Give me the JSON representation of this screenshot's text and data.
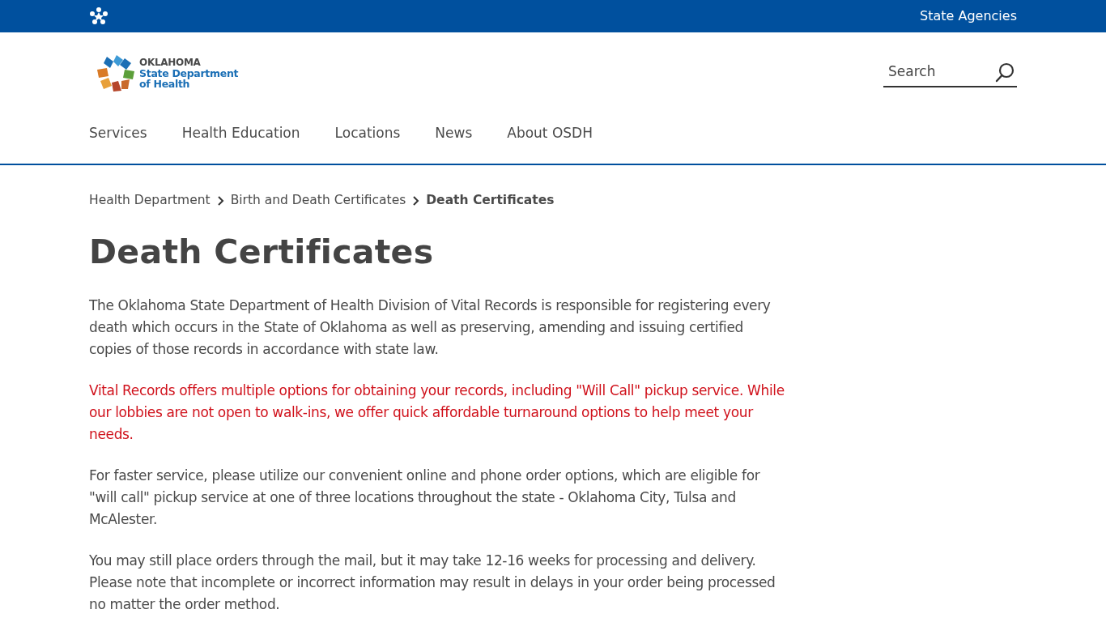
{
  "top_bar": {
    "link": "State Agencies"
  },
  "logo": {
    "lines": [
      "OKLAHOMA",
      "State Department",
      "of Health"
    ]
  },
  "search": {
    "placeholder": "Search"
  },
  "nav": [
    {
      "label": "Services"
    },
    {
      "label": "Health Education"
    },
    {
      "label": "Locations"
    },
    {
      "label": "News"
    },
    {
      "label": "About OSDH"
    }
  ],
  "breadcrumbs": [
    {
      "label": "Health Department",
      "current": false
    },
    {
      "label": "Birth and Death Certificates",
      "current": false
    },
    {
      "label": "Death Certificates",
      "current": true
    }
  ],
  "title": "Death Certificates",
  "paragraphs": [
    {
      "kind": "body",
      "text": "The Oklahoma State Department of Health Division of Vital Records is responsible for registering every death which occurs in the State of Oklahoma as well as preserving, amending and issuing certified copies of those records in accordance with state law."
    },
    {
      "kind": "notice",
      "text": "Vital Records offers multiple options for obtaining your records, including \"Will Call\" pickup service. While our lobbies are not open to walk-ins, we offer quick affordable turnaround options to help meet your needs."
    },
    {
      "kind": "body",
      "text": "For faster service, please utilize our convenient online and phone order options, which are eligible for \"will call\" pickup service at one of three locations throughout the state - Oklahoma City, Tulsa and McAlester."
    },
    {
      "kind": "body",
      "text": "You may still place orders through the mail, but it may take 12-16 weeks for processing and delivery. Please note that incomplete or incorrect information may result in delays in your order being processed no matter the order method."
    }
  ]
}
